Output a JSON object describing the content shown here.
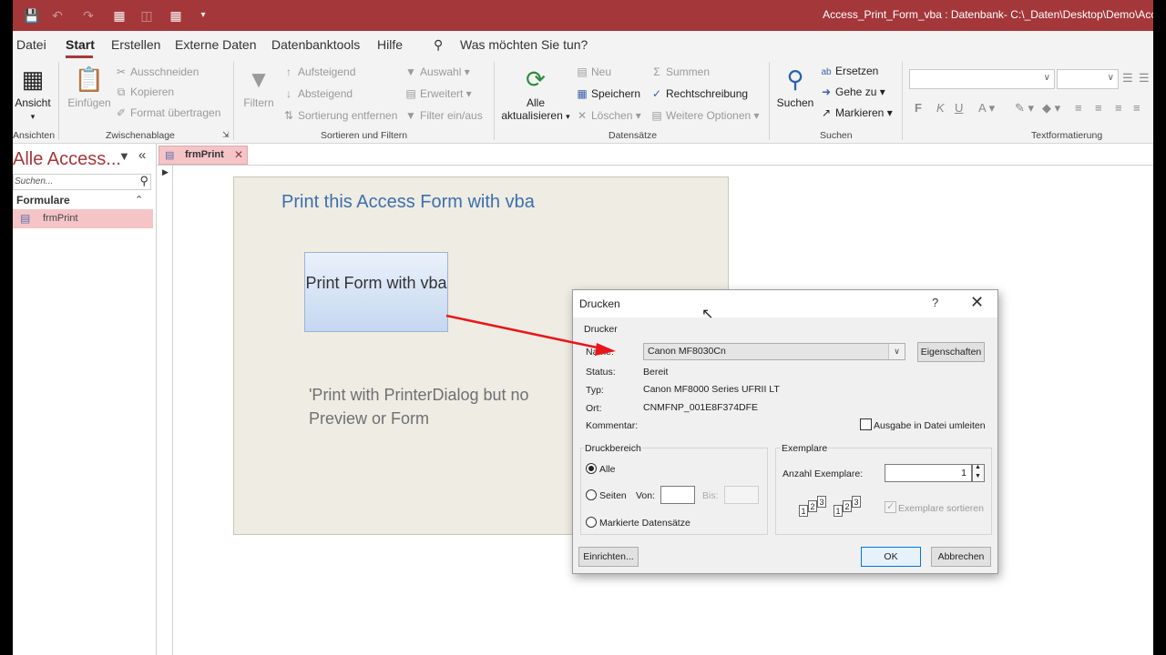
{
  "titlebar": {
    "title": "Access_Print_Form_vba : Datenbank- C:\\_Daten\\Desktop\\Demo\\Acce",
    "accent": "#a4373a"
  },
  "menu": {
    "tabs": [
      {
        "label": "Datei"
      },
      {
        "label": "Start"
      },
      {
        "label": "Erstellen"
      },
      {
        "label": "Externe Daten"
      },
      {
        "label": "Datenbanktools"
      },
      {
        "label": "Hilfe"
      }
    ],
    "tell_me": "Was möchten Sie tun?"
  },
  "ribbon": {
    "ansicht": {
      "label": "Ansicht",
      "group": "Ansichten"
    },
    "clipboard": {
      "paste": "Einfügen",
      "cut": "Ausschneiden",
      "copy": "Kopieren",
      "format_painter": "Format übertragen",
      "group": "Zwischenablage"
    },
    "sort": {
      "filter": "Filtern",
      "asc": "Aufsteigend",
      "desc": "Absteigend",
      "remove": "Sortierung entfernen",
      "selection": "Auswahl",
      "advanced": "Erweitert",
      "toggle": "Filter ein/aus",
      "group": "Sortieren und Filtern"
    },
    "records": {
      "refresh_1": "Alle",
      "refresh_2": "aktualisieren",
      "new": "Neu",
      "save": "Speichern",
      "delete": "Löschen",
      "totals": "Summen",
      "spelling": "Rechtschreibung",
      "more": "Weitere Optionen",
      "group": "Datensätze"
    },
    "find": {
      "find": "Suchen",
      "replace": "Ersetzen",
      "goto": "Gehe zu",
      "select": "Markieren",
      "group": "Suchen"
    },
    "text_format": {
      "bold": "F",
      "italic": "K",
      "underline": "U",
      "group": "Textformatierung"
    }
  },
  "nav": {
    "title": "Alle Access...",
    "search_placeholder": "Suchen...",
    "group": "Formulare",
    "items": [
      {
        "label": "frmPrint"
      }
    ]
  },
  "document": {
    "tab_label": "frmPrint",
    "form_title": "Print this Access Form with vba",
    "button_label": "Print Form with vba",
    "comment": "'Print with PrinterDialog but no Preview or Form"
  },
  "dialog": {
    "title": "Drucken",
    "help": "?",
    "printer_group": "Drucker",
    "name_label": "Name:",
    "printer_name": "Canon MF8030Cn",
    "properties_button": "Eigenschaften",
    "status_label": "Status:",
    "status_value": "Bereit",
    "type_label": "Typ:",
    "type_value": "Canon MF8000 Series UFRII LT",
    "location_label": "Ort:",
    "location_value": "CNMFNP_001E8F374DFE",
    "comment_label": "Kommentar:",
    "print_to_file": "Ausgabe in Datei umleiten",
    "range_group": "Druckbereich",
    "range_all": "Alle",
    "range_pages": "Seiten",
    "from_label": "Von:",
    "to_label": "Bis:",
    "range_selection": "Markierte Datensätze",
    "copies_group": "Exemplare",
    "copies_label": "Anzahl Exemplare:",
    "copies_value": "1",
    "collate": "Exemplare sortieren",
    "setup_button": "Einrichten...",
    "ok_button": "OK",
    "cancel_button": "Abbrechen",
    "range_selected": "all"
  },
  "annotation_arrow_color": "#e8161b"
}
